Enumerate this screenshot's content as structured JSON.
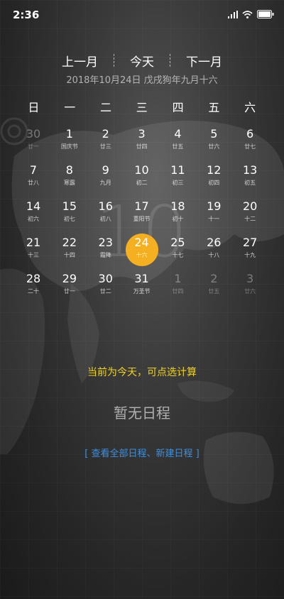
{
  "status_bar": {
    "time": "2:36"
  },
  "nav": {
    "prev": "上一月",
    "today": "今天",
    "next": "下一月"
  },
  "subtitle": "2018年10月24日 戊戌狗年九月十六",
  "big_month": "10",
  "weekdays": [
    "日",
    "一",
    "二",
    "三",
    "四",
    "五",
    "六"
  ],
  "weeks": [
    [
      {
        "d": "30",
        "l": "廿一",
        "dim": true
      },
      {
        "d": "1",
        "l": "国庆节"
      },
      {
        "d": "2",
        "l": "廿三"
      },
      {
        "d": "3",
        "l": "廿四"
      },
      {
        "d": "4",
        "l": "廿五"
      },
      {
        "d": "5",
        "l": "廿六"
      },
      {
        "d": "6",
        "l": "廿七"
      }
    ],
    [
      {
        "d": "7",
        "l": "廿八"
      },
      {
        "d": "8",
        "l": "寒露"
      },
      {
        "d": "9",
        "l": "九月"
      },
      {
        "d": "10",
        "l": "初二"
      },
      {
        "d": "11",
        "l": "初三"
      },
      {
        "d": "12",
        "l": "初四"
      },
      {
        "d": "13",
        "l": "初五"
      }
    ],
    [
      {
        "d": "14",
        "l": "初六"
      },
      {
        "d": "15",
        "l": "初七"
      },
      {
        "d": "16",
        "l": "初八"
      },
      {
        "d": "17",
        "l": "重阳节"
      },
      {
        "d": "18",
        "l": "初十"
      },
      {
        "d": "19",
        "l": "十一"
      },
      {
        "d": "20",
        "l": "十二"
      }
    ],
    [
      {
        "d": "21",
        "l": "十三"
      },
      {
        "d": "22",
        "l": "十四"
      },
      {
        "d": "23",
        "l": "霜降"
      },
      {
        "d": "24",
        "l": "十六",
        "today": true
      },
      {
        "d": "25",
        "l": "十七"
      },
      {
        "d": "26",
        "l": "十八"
      },
      {
        "d": "27",
        "l": "十九"
      }
    ],
    [
      {
        "d": "28",
        "l": "二十"
      },
      {
        "d": "29",
        "l": "廿一"
      },
      {
        "d": "30",
        "l": "廿二"
      },
      {
        "d": "31",
        "l": "万圣节"
      },
      {
        "d": "1",
        "l": "廿四",
        "dim": true
      },
      {
        "d": "2",
        "l": "廿五",
        "dim": true
      },
      {
        "d": "3",
        "l": "廿六",
        "dim": true
      }
    ]
  ],
  "hint": "当前为今天，可点选计算",
  "empty_text": "暂无日程",
  "links": "[ 查看全部日程、新建日程 ]",
  "colors": {
    "today": "#f5b022",
    "hint": "#f1d21f",
    "link": "#3e8fe0"
  }
}
